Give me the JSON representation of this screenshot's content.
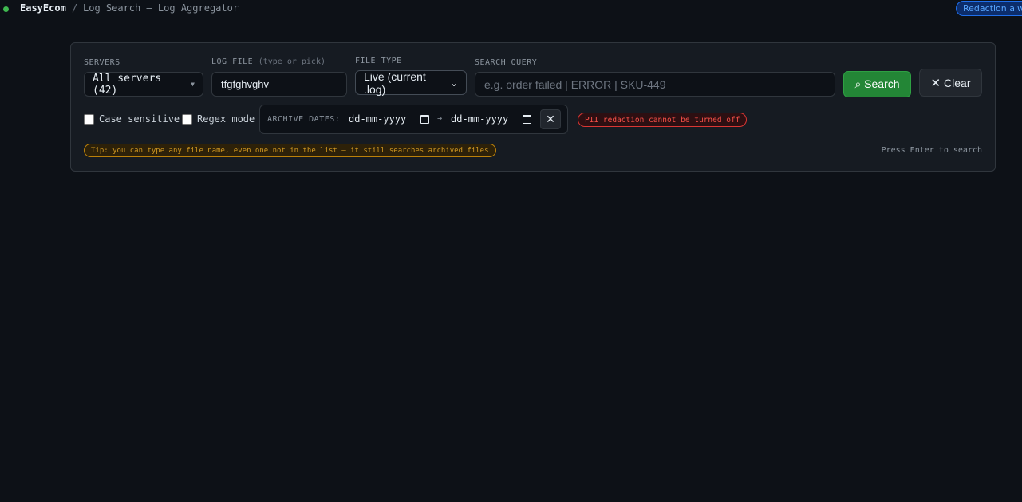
{
  "header": {
    "brand": "EasyEcom",
    "separator": "/",
    "title": "Log Search — Log Aggregator",
    "redaction_badge": "Redaction always on"
  },
  "search": {
    "servers_label": "SERVERS",
    "servers_value": "All servers (42)",
    "logfile_label": "LOG FILE",
    "logfile_hint": "(type or pick)",
    "logfile_value": "tfgfghvghv",
    "filetype_label": "FILE TYPE",
    "filetype_value": "Live (current .log)",
    "query_label": "SEARCH QUERY",
    "query_placeholder": "e.g. order failed  |  ERROR  |  SKU-449",
    "search_button": "⌕ Search",
    "clear_button": "Clear",
    "case_sensitive_label": "Case sensitive",
    "regex_label": "Regex mode",
    "case_sensitive_checked": false,
    "regex_checked": false,
    "archive_label": "ARCHIVE DATES:",
    "date_from": "dd-mm-yyyy",
    "date_to": "dd-mm-yyyy",
    "date_arrow": "→",
    "pii_badge": "PII redaction cannot be turned off",
    "tip": "Tip: you can type any file name, even one not in the list — it still searches archived files",
    "enter_hint": "Press Enter to search"
  },
  "colors": {
    "background": "#0d1117",
    "panel": "#161b22",
    "accent_green": "#238636",
    "status_dot": "#3fb950",
    "warning": "#d29922",
    "danger": "#f85149",
    "info": "#58a6ff"
  }
}
